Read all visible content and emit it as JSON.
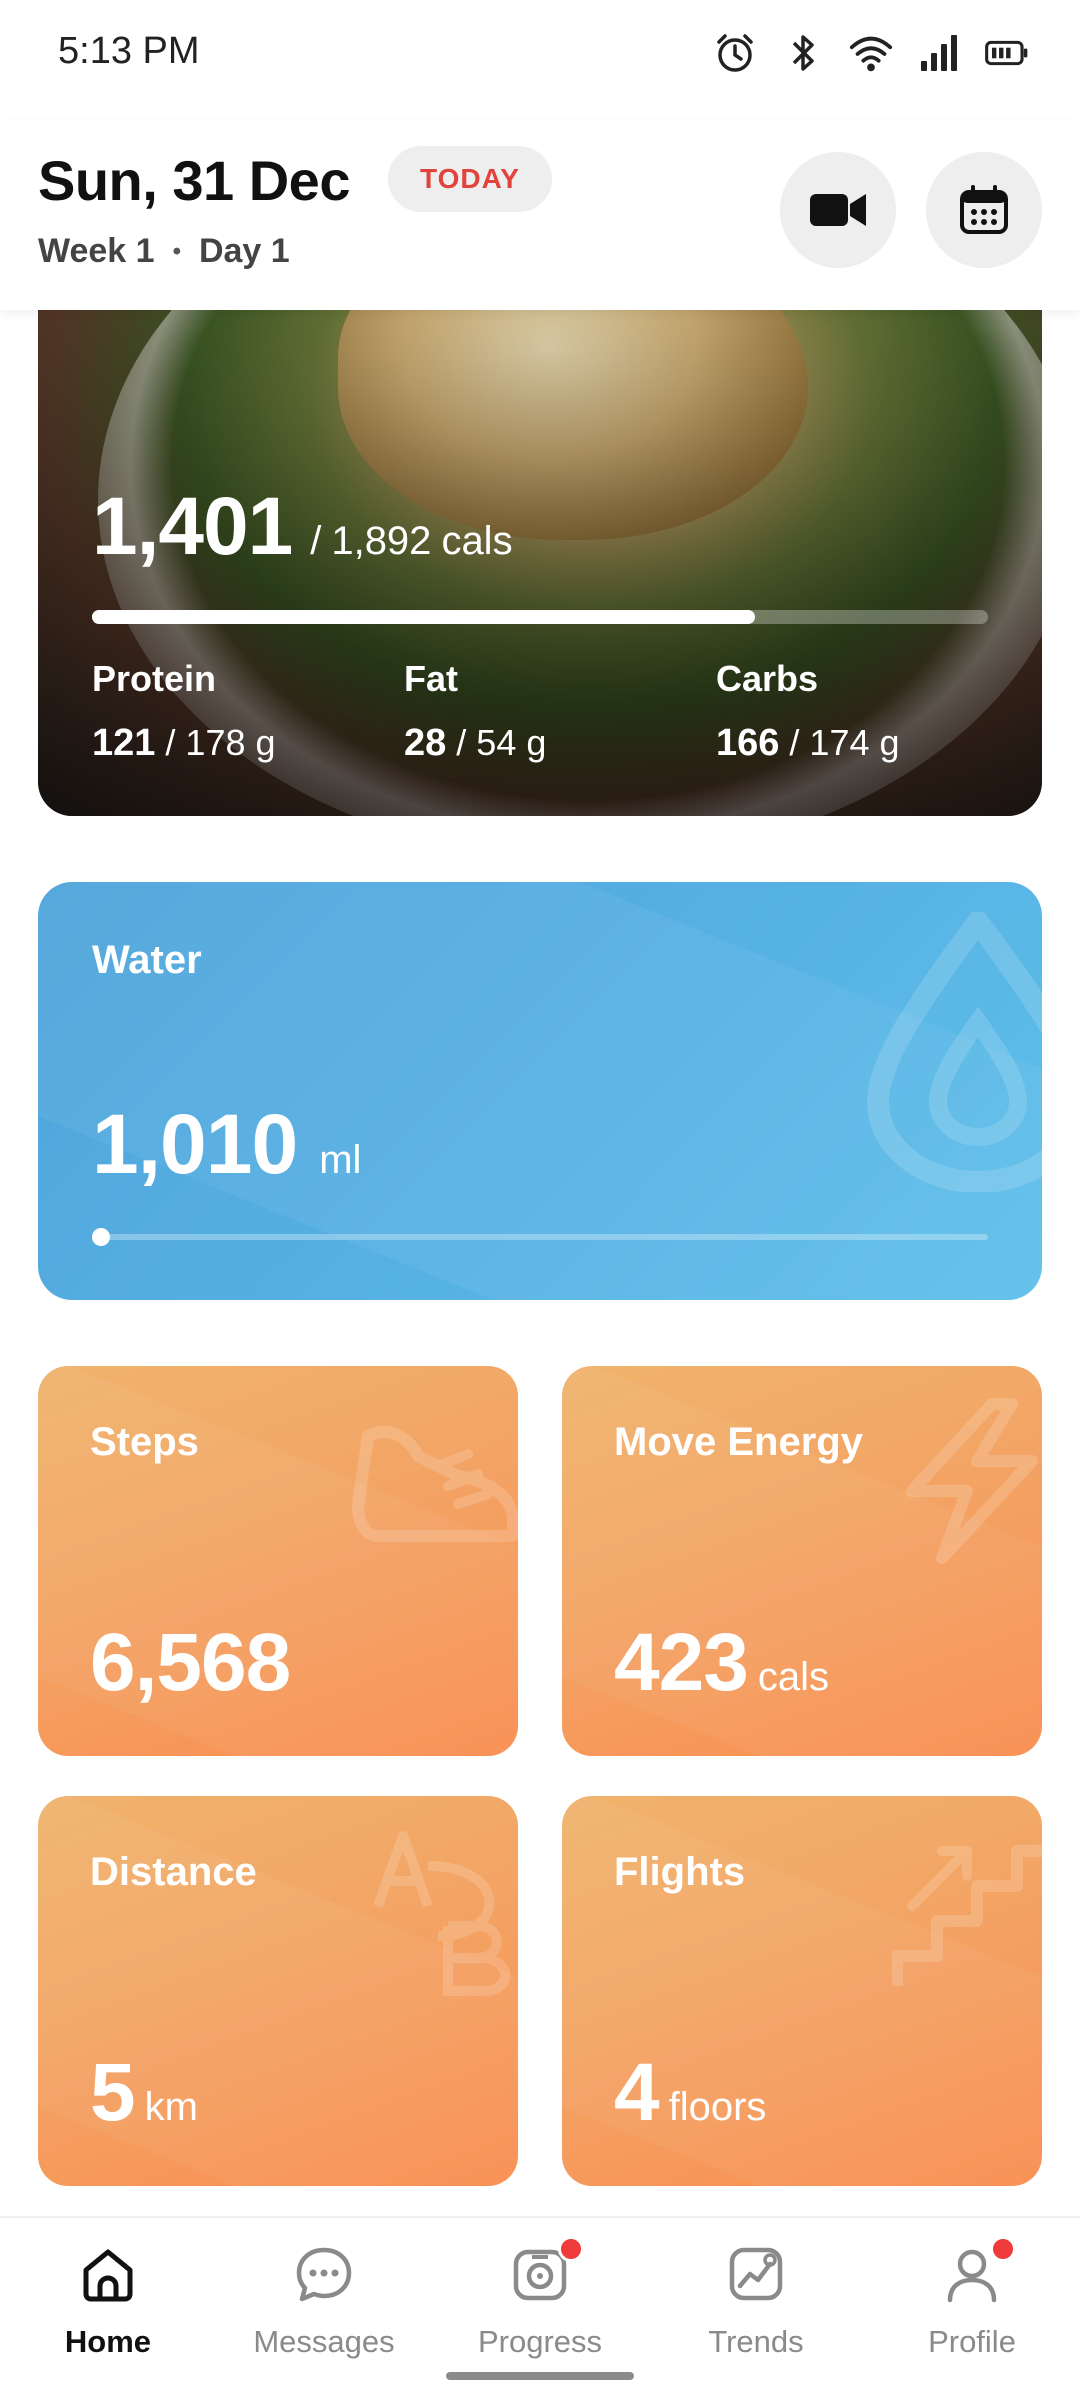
{
  "status_bar": {
    "time": "5:13 PM",
    "icons": [
      "alarm-icon",
      "bluetooth-icon",
      "wifi-icon",
      "signal-icon",
      "battery-icon"
    ]
  },
  "header": {
    "date": "Sun, 31 Dec",
    "today_badge": "TODAY",
    "week": "Week 1",
    "separator": "•",
    "day": "Day 1",
    "actions": [
      "video-camera-icon",
      "calendar-icon"
    ]
  },
  "food": {
    "calories_value": "1,401",
    "calories_goal": "1,892",
    "calories_unit": "cals",
    "slash": "/",
    "progress": 0.74,
    "macros": [
      {
        "label": "Protein",
        "value": "121",
        "goal": "178 g"
      },
      {
        "label": "Fat",
        "value": "28",
        "goal": "54 g"
      },
      {
        "label": "Carbs",
        "value": "166",
        "goal": "174 g"
      }
    ]
  },
  "water": {
    "label": "Water",
    "value": "1,010",
    "unit": "ml",
    "progress": 0.0,
    "icon": "water-drop-icon"
  },
  "tiles": {
    "steps": {
      "label": "Steps",
      "value": "6,568",
      "unit": "",
      "icon": "shoe-icon"
    },
    "move": {
      "label": "Move Energy",
      "value": "423",
      "unit": "cals",
      "icon": "lightning-icon"
    },
    "distance": {
      "label": "Distance",
      "value": "5",
      "unit": "km",
      "icon": "a-to-b-icon"
    },
    "flights": {
      "label": "Flights",
      "value": "4",
      "unit": "floors",
      "icon": "stairs-icon"
    }
  },
  "nav": {
    "items": [
      {
        "label": "Home",
        "active": true,
        "badge": false
      },
      {
        "label": "Messages",
        "active": false,
        "badge": false
      },
      {
        "label": "Progress",
        "active": false,
        "badge": true
      },
      {
        "label": "Trends",
        "active": false,
        "badge": false
      },
      {
        "label": "Profile",
        "active": false,
        "badge": true
      }
    ]
  },
  "colors": {
    "today_red": "#e2433c",
    "water_blue": "#56b0e3",
    "tile_orange": "#f3a465",
    "badge_red": "#f03b3b"
  }
}
